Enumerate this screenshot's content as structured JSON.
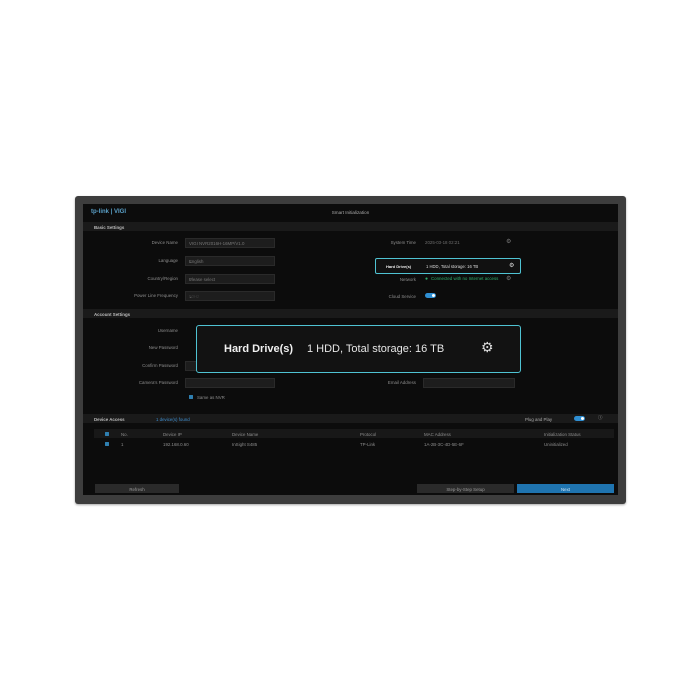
{
  "app": {
    "logo": "tp-link | VIGI",
    "title": "Smart Initialization"
  },
  "basic": {
    "header": "Basic Settings",
    "device_name_label": "Device Name",
    "device_name_value": "VIGI NVR2016H-16MP/V1.0",
    "language_label": "Language",
    "language_value": "English",
    "country_label": "Country/Region",
    "country_value": "Please select",
    "power_label": "Power Line Frequency",
    "power_value": "50Hz",
    "system_time_label": "System Time",
    "system_time_value": "2025-03-18 02:21",
    "hdd_label": "Hard Drive(s)",
    "hdd_value": "1 HDD, Total storage: 16 TB",
    "network_label": "Network",
    "network_value": "Connected with no Internet access",
    "cloud_label": "Cloud Service"
  },
  "account": {
    "header": "Account Settings",
    "username_label": "Username",
    "new_password_label": "New Password",
    "confirm_password_label": "Confirm Password",
    "camera_password_label": "Camera's Password",
    "same_as_nvr_label": "Same as NVR",
    "email_label": "Email Address"
  },
  "zoom": {
    "label": "Hard Drive(s)",
    "value": "1 HDD, Total storage: 16 TB"
  },
  "device_access": {
    "header": "Device Access",
    "found": "1 device(s) found",
    "plug_play_label": "Plug and Play",
    "columns": [
      "No.",
      "Device IP",
      "Device Name",
      "Protocol",
      "MAC Address",
      "Initialization Status"
    ],
    "rows": [
      {
        "no": "1",
        "ip": "192.168.0.60",
        "name": "InSight S485",
        "protocol": "TP-Link",
        "mac": "1A-2B-3C-4D-5E-6F",
        "status": "Uninitialized"
      }
    ]
  },
  "buttons": {
    "refresh": "Refresh",
    "step_setup": "Step-by-Step Setup",
    "next": "Next"
  },
  "colors": {
    "accent": "#4fc3d3",
    "primary": "#1f74b0"
  }
}
